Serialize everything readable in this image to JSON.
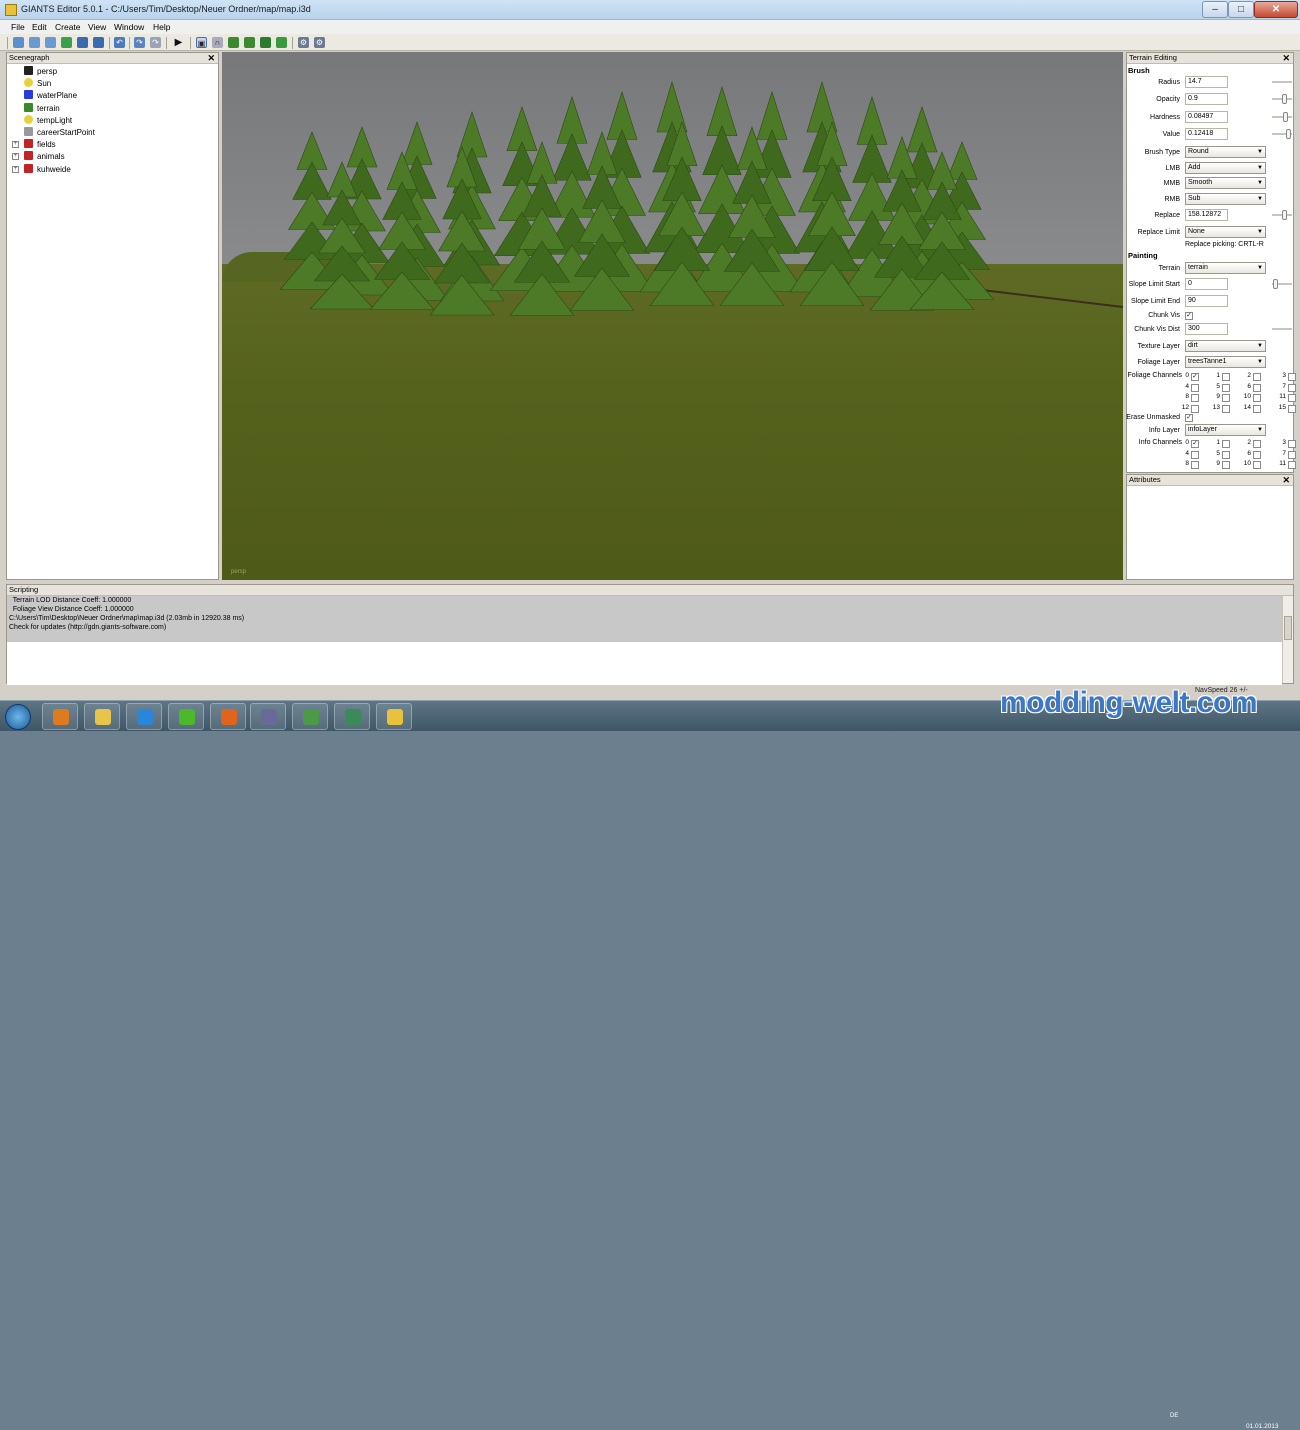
{
  "window": {
    "title": "GIANTS Editor 5.0.1 - C:/Users/Tim/Desktop/Neuer Ordner/map/map.i3d",
    "min": "–",
    "max": "□",
    "close": "✕"
  },
  "menu": [
    "File",
    "Edit",
    "Create",
    "View",
    "Window",
    "Help"
  ],
  "toolbar_icons": [
    "new-file-icon",
    "open-file-icon",
    "open-recent-icon",
    "save-icon",
    "save-as-icon",
    "import-icon",
    "undo-icon",
    "redo-icon",
    "play-icon",
    "select-tool-icon",
    "move-tool-icon",
    "terrain-sculpt-icon",
    "terrain-paint-icon",
    "foliage-paint-icon",
    "grass-paint-icon",
    "settings-icon",
    "settings-alt-icon"
  ],
  "scenegraph": {
    "title": "Scenegraph",
    "items": [
      {
        "label": "persp",
        "icon": "camera-icon",
        "color": "#222222"
      },
      {
        "label": "Sun",
        "icon": "light-bulb-icon",
        "color": "#e8d23c"
      },
      {
        "label": "waterPlane",
        "icon": "cube-icon",
        "color": "#2a3ce0"
      },
      {
        "label": "terrain",
        "icon": "terrain-icon",
        "color": "#3a8a2a"
      },
      {
        "label": "tempLight",
        "icon": "light-bulb-icon",
        "color": "#e8d23c"
      },
      {
        "label": "careerStartPoint",
        "icon": "transform-group-icon",
        "color": "#999999"
      },
      {
        "label": "fields",
        "icon": "transform-group-icon",
        "color": "#c02424",
        "expandable": true
      },
      {
        "label": "animals",
        "icon": "transform-group-icon",
        "color": "#c02424",
        "expandable": true
      },
      {
        "label": "kuhweide",
        "icon": "transform-group-icon",
        "color": "#c02424",
        "expandable": true
      }
    ]
  },
  "viewport": {
    "camera_label": "persp"
  },
  "terrain_editing": {
    "title": "Terrain Editing",
    "brush_title": "Brush",
    "radius_label": "Radius",
    "radius": "14.7",
    "opacity_label": "Opacity",
    "opacity": "0.9",
    "hardness_label": "Hardness",
    "hardness": "0.08497",
    "value_label": "Value",
    "value": "0.12418",
    "brush_type_label": "Brush Type",
    "brush_type": "Round",
    "lmb_label": "LMB",
    "lmb": "Add",
    "mmb_label": "MMB",
    "mmb": "Smooth",
    "rmb_label": "RMB",
    "rmb": "Sub",
    "replace_label": "Replace",
    "replace": "158.12872",
    "replace_limit_label": "Replace Limit",
    "replace_limit": "None",
    "replace_hint": "Replace picking: CRTL-R",
    "painting_title": "Painting",
    "terrain_label": "Terrain",
    "terrain": "terrain",
    "slope_start_label": "Slope Limit Start",
    "slope_start": "0",
    "slope_end_label": "Slope Limit End",
    "slope_end": "90",
    "chunk_vis_label": "Chunk Vis",
    "chunk_vis_checked": true,
    "chunk_vis_dist_label": "Chunk Vis Dist",
    "chunk_vis_dist": "300",
    "texture_layer_label": "Texture Layer",
    "texture_layer": "dirt",
    "foliage_layer_label": "Foliage Layer",
    "foliage_layer": "treesTanne1",
    "foliage_channels_label": "Foliage Channels",
    "foliage_channels": [
      "0",
      "1",
      "2",
      "3",
      "4",
      "5",
      "6",
      "7",
      "8",
      "9",
      "10",
      "11",
      "12",
      "13",
      "14",
      "15"
    ],
    "foliage_channels_checked": [
      true,
      false,
      false,
      false,
      false,
      false,
      false,
      false,
      false,
      false,
      false,
      false,
      false,
      false,
      false,
      false
    ],
    "erase_unmasked_label": "Erase Unmasked",
    "erase_unmasked_checked": true,
    "info_layer_label": "Info Layer",
    "info_layer": "infoLayer",
    "info_channels_label": "Info Channels",
    "info_channels": [
      "0",
      "1",
      "2",
      "3",
      "4",
      "5",
      "6",
      "7",
      "8",
      "9",
      "10",
      "11"
    ],
    "info_channels_checked": [
      true,
      false,
      false,
      false,
      false,
      false,
      false,
      false,
      false,
      false,
      false,
      false
    ],
    "slider_levels": {
      "radius": 0.05,
      "opacity": 0.9,
      "hardness": 0.9,
      "value": 1.0,
      "replace": 0.9,
      "slope_start": 0.1
    }
  },
  "attributes": {
    "title": "Attributes"
  },
  "scripting": {
    "title": "Scripting",
    "log": [
      "  Terrain LOD Distance Coeff: 1.000000",
      "  Foliage View Distance Coeff: 1.000000",
      "C:\\Users\\Tim\\Desktop\\Neuer Ordner\\map\\map.i3d (2.03mb in 12920.38 ms)",
      "Check for updates (http://gdn.giants-software.com)"
    ]
  },
  "status": {
    "speed": "NavSpeed 26 +/-"
  },
  "taskbar": {
    "apps": [
      {
        "icon": "media-player-icon",
        "color": "#e07a1e"
      },
      {
        "icon": "explorer-folder-icon",
        "color": "#e8c44a"
      },
      {
        "icon": "internet-explorer-icon",
        "color": "#2a86d8"
      },
      {
        "icon": "icq-flower-icon",
        "color": "#4cb82c"
      },
      {
        "icon": "firefox-icon",
        "color": "#e0641c"
      },
      {
        "icon": "image-editor-icon",
        "color": "#6a6a9a"
      },
      {
        "icon": "chart-app-icon",
        "color": "#4a9a4a"
      },
      {
        "icon": "network-app-icon",
        "color": "#3a8a5a"
      },
      {
        "icon": "giants-editor-icon",
        "color": "#e8c23a"
      }
    ],
    "lang": "DE",
    "date": "01.01.2013"
  },
  "watermark": "modding-welt.com"
}
